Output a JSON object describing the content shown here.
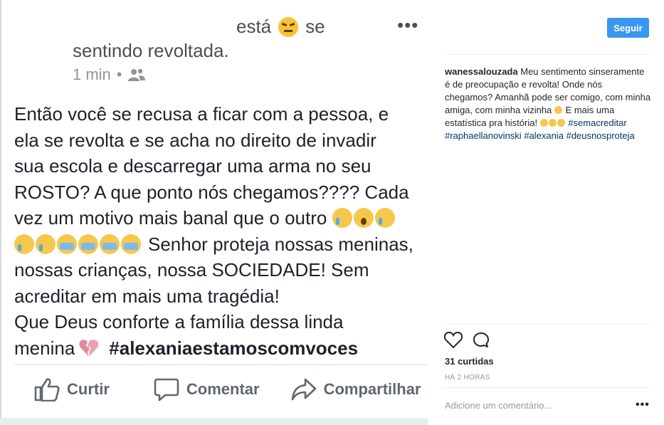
{
  "fb_post": {
    "status_prefix": "está",
    "status_suffix": "se",
    "feeling": "sentindo revoltada.",
    "time": "1 min",
    "meta_separator": "•",
    "more_icon": "•••",
    "text_lines": [
      "Então você se recusa a ficar com a pessoa, e",
      "ela se revolta e se acha no direito de invadir",
      "sua escola e descarregar uma arma no seu",
      "ROSTO? A que ponto nós chegamos???? Cada",
      "vez um motivo mais banal que o outro",
      "Senhor proteja nossas meninas,",
      "nossas crianças, nossa SOCIEDADE! Sem",
      "acreditar em mais uma tragédia!",
      "Que Deus conforte a família dessa linda",
      "menina"
    ],
    "hashtag": "#alexaniaestamoscomvoces",
    "actions": {
      "like": "Curtir",
      "comment": "Comentar",
      "share": "Compartilhar"
    }
  },
  "instagram": {
    "follow_label": "Seguir",
    "caption": {
      "username": "wanessalouzada",
      "text": "Meu sentimento sinseramente é de preocupação e revolta! Onde nós chegamos? Amanhã pode ser comigo, com minha amiga, com minha vizinha",
      "text2": "E mais uma estatística pra história!",
      "hashtags": [
        "#semacreditar",
        "#raphaellanovinski",
        "#alexania",
        "#deusnosproteja"
      ]
    },
    "likes": "31 curtidas",
    "time": "HÁ 2 HORAS",
    "comment_placeholder": "Adicione um comentário...",
    "comment_more": "•••"
  },
  "colors": {
    "follow_button": "#3897f0",
    "hashtag": "#003569",
    "fb_text": "#1d2129",
    "fb_meta": "#90949c"
  }
}
